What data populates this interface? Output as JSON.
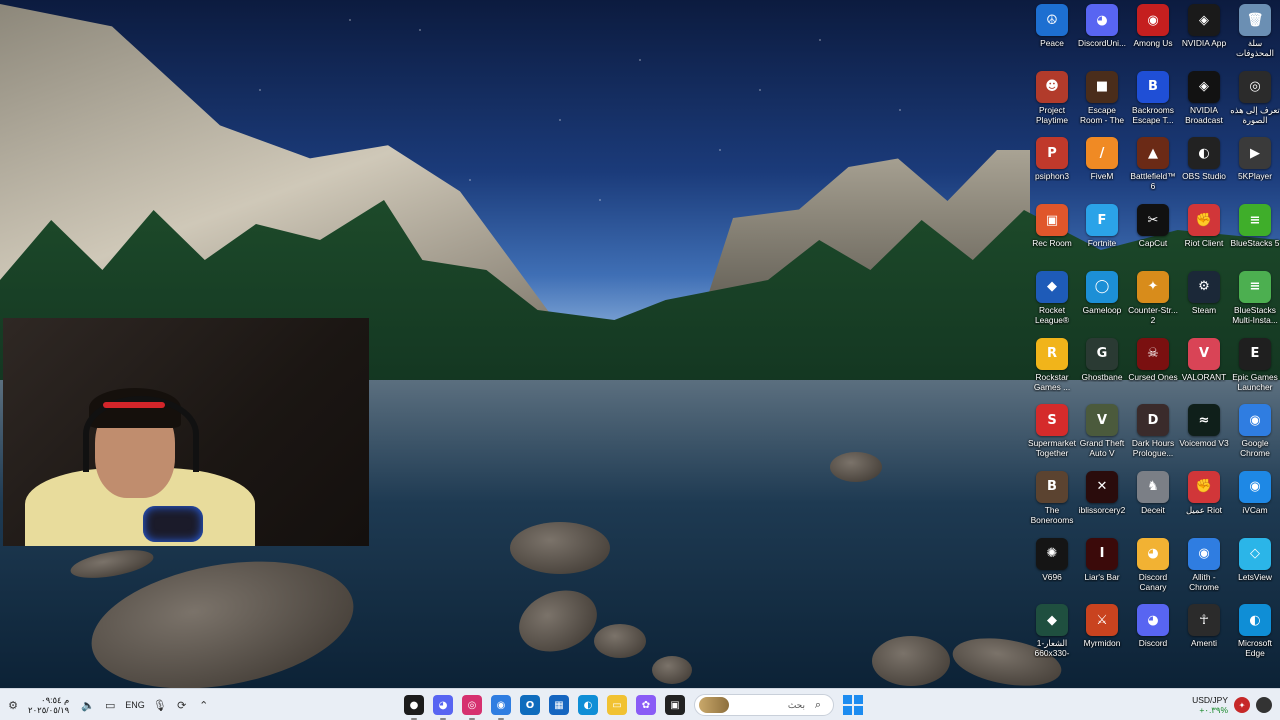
{
  "desktop": {
    "icons": [
      {
        "label": "Peace",
        "glyph": "☮",
        "color": "#1d6fd1"
      },
      {
        "label": "DiscordUni...",
        "glyph": "◕",
        "color": "#5865f2"
      },
      {
        "label": "Among Us",
        "glyph": "◉",
        "color": "#c51f1f"
      },
      {
        "label": "NVIDIA App",
        "glyph": "◈",
        "color": "#1a1a1a"
      },
      {
        "label": "سلة المحذوفات",
        "glyph": "🗑",
        "color": "#6b8fb3"
      },
      {
        "label": "Project Playtime",
        "glyph": "☻",
        "color": "#b23b2b"
      },
      {
        "label": "Escape Room - The Sick ...",
        "glyph": "■",
        "color": "#4a2d1b"
      },
      {
        "label": "Backrooms Escape T...",
        "glyph": "B",
        "color": "#1f4fd6"
      },
      {
        "label": "NVIDIA Broadcast",
        "glyph": "◈",
        "color": "#121212"
      },
      {
        "label": "تعرف إلى هذه الصورة",
        "glyph": "◎",
        "color": "#2b2b2b"
      },
      {
        "label": "psiphon3",
        "glyph": "P",
        "color": "#c0392b"
      },
      {
        "label": "FiveM",
        "glyph": "/",
        "color": "#f08a24"
      },
      {
        "label": "Battlefield™ 6",
        "glyph": "▲",
        "color": "#6b2a16"
      },
      {
        "label": "OBS Studio",
        "glyph": "◐",
        "color": "#222"
      },
      {
        "label": "5KPlayer",
        "glyph": "▶",
        "color": "#3a3a3a"
      },
      {
        "label": "Rec Room",
        "glyph": "▣",
        "color": "#e0562b"
      },
      {
        "label": "Fortnite",
        "glyph": "F",
        "color": "#2ba3e8"
      },
      {
        "label": "CapCut",
        "glyph": "✂",
        "color": "#111"
      },
      {
        "label": "Riot Client",
        "glyph": "✊",
        "color": "#d13639"
      },
      {
        "label": "BlueStacks 5",
        "glyph": "≡",
        "color": "#3fae2a"
      },
      {
        "label": "Rocket League®",
        "glyph": "◆",
        "color": "#1e5bb8"
      },
      {
        "label": "Gameloop",
        "glyph": "◯",
        "color": "#1c8fd6"
      },
      {
        "label": "Counter-Str... 2",
        "glyph": "✦",
        "color": "#d88c1b"
      },
      {
        "label": "Steam",
        "glyph": "⚙",
        "color": "#1b2838"
      },
      {
        "label": "BlueStacks Multi-Insta...",
        "glyph": "≡",
        "color": "#4caf50"
      },
      {
        "label": "Rockstar Games ...",
        "glyph": "R",
        "color": "#f1b41a"
      },
      {
        "label": "Ghostbane",
        "glyph": "G",
        "color": "#2a3a33"
      },
      {
        "label": "Cursed Ones",
        "glyph": "☠",
        "color": "#7a1010"
      },
      {
        "label": "VALORANT",
        "glyph": "V",
        "color": "#d94456"
      },
      {
        "label": "Epic Games Launcher",
        "glyph": "E",
        "color": "#1f1f1f"
      },
      {
        "label": "Supermarket Together",
        "glyph": "S",
        "color": "#d52b2b"
      },
      {
        "label": "Grand Theft Auto V",
        "glyph": "V",
        "color": "#4b5a3c"
      },
      {
        "label": "Dark Hours Prologue...",
        "glyph": "D",
        "color": "#3a2b2b"
      },
      {
        "label": "Voicemod V3",
        "glyph": "≈",
        "color": "#0f1f1a"
      },
      {
        "label": "Google Chrome",
        "glyph": "◉",
        "color": "#2f7de1"
      },
      {
        "label": "The Bonerooms",
        "glyph": "B",
        "color": "#5b4330"
      },
      {
        "label": "iblissorcery2",
        "glyph": "✕",
        "color": "#2a0c0c"
      },
      {
        "label": "Deceit",
        "glyph": "♞",
        "color": "#7b7f86"
      },
      {
        "label": "عميل Riot",
        "glyph": "✊",
        "color": "#d13639"
      },
      {
        "label": "iVCam",
        "glyph": "◉",
        "color": "#1e88e5"
      },
      {
        "label": "V696",
        "glyph": "✺",
        "color": "#151515"
      },
      {
        "label": "Liar's Bar",
        "glyph": "I",
        "color": "#3b0a0a"
      },
      {
        "label": "Discord Canary",
        "glyph": "◕",
        "color": "#f2b233"
      },
      {
        "label": "Allith - Chrome",
        "glyph": "◉",
        "color": "#2f7de1"
      },
      {
        "label": "LetsView",
        "glyph": "◇",
        "color": "#2bb5e8"
      },
      {
        "label": "الشعار-1 660x330-",
        "glyph": "◆",
        "color": "#1f4f3f"
      },
      {
        "label": "Myrmidon",
        "glyph": "⚔",
        "color": "#c9431f"
      },
      {
        "label": "Discord",
        "glyph": "◕",
        "color": "#5865f2"
      },
      {
        "label": "Amenti",
        "glyph": "☥",
        "color": "#2b2b2b"
      },
      {
        "label": "Microsoft Edge",
        "glyph": "◐",
        "color": "#0f8ed6"
      }
    ]
  },
  "taskbar": {
    "clock_time": "م ٠٩:٥٤",
    "clock_date": "٢٠٢٥/٠٥/١٩",
    "language": "ENG",
    "search_placeholder": "بحث",
    "ticker_pair": "USD/JPY",
    "ticker_change": "+٠.٣٩%",
    "apps": [
      {
        "name": "gta-app",
        "glyph": "●",
        "color": "#1c1c1c"
      },
      {
        "name": "discord-app",
        "glyph": "◕",
        "color": "#5865f2"
      },
      {
        "name": "instagram-app",
        "glyph": "◎",
        "color": "#d6316f"
      },
      {
        "name": "chrome-app",
        "glyph": "◉",
        "color": "#2f7de1"
      },
      {
        "name": "outlook-app",
        "glyph": "O",
        "color": "#0f6cbd"
      },
      {
        "name": "store-app",
        "glyph": "▦",
        "color": "#1565c0"
      },
      {
        "name": "edge-app",
        "glyph": "◐",
        "color": "#0f8ed6"
      },
      {
        "name": "explorer-app",
        "glyph": "▭",
        "color": "#f1c232"
      },
      {
        "name": "copilot-app",
        "glyph": "✿",
        "color": "#8a5cf6"
      },
      {
        "name": "terminal-app",
        "glyph": "▣",
        "color": "#222"
      }
    ]
  }
}
